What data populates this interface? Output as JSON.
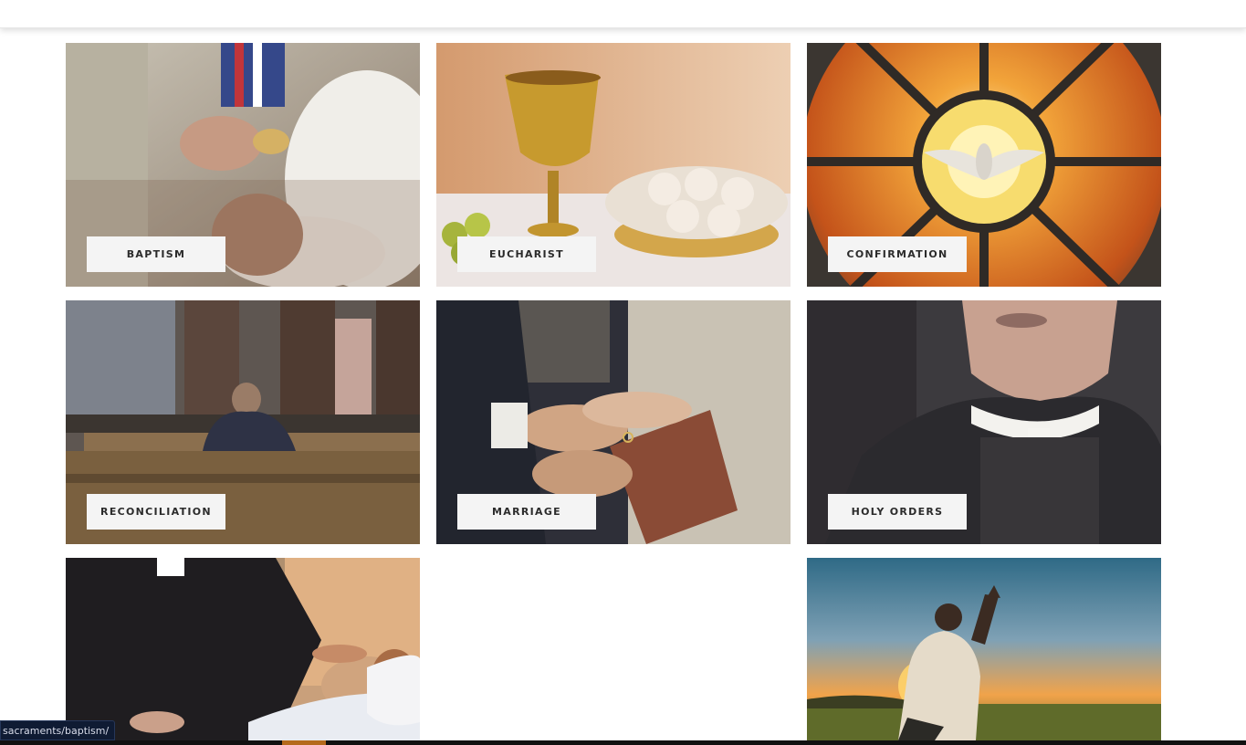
{
  "status_url": "sacraments/baptism/",
  "sacraments": [
    {
      "label": "BAPTISM",
      "scene": "baptism"
    },
    {
      "label": "EUCHARIST",
      "scene": "eucharist"
    },
    {
      "label": "CONFIRMATION",
      "scene": "confirmation"
    },
    {
      "label": "RECONCILIATION",
      "scene": "reconciliation"
    },
    {
      "label": "MARRIAGE",
      "scene": "marriage"
    },
    {
      "label": "HOLY ORDERS",
      "scene": "holy-orders"
    },
    {
      "label": "",
      "scene": "anointing-of-the-sick"
    },
    {
      "label": "",
      "scene": "prayer-at-sunset"
    }
  ],
  "colors": {
    "label_bg": "#f4f4f4",
    "label_text": "#2b2b2b",
    "status_bg": "#0f1b33",
    "accent": "#b56a1c"
  }
}
